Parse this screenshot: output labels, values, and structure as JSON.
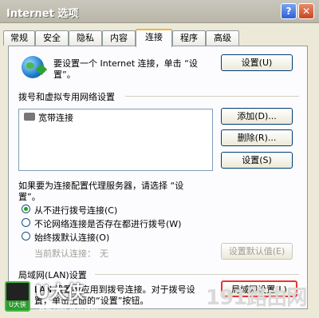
{
  "window": {
    "title": "Internet 选项",
    "help_label": "?",
    "close_label": "✕"
  },
  "tabs": [
    {
      "label": "常规"
    },
    {
      "label": "安全"
    },
    {
      "label": "隐私"
    },
    {
      "label": "内容"
    },
    {
      "label": "连接",
      "active": true
    },
    {
      "label": "程序"
    },
    {
      "label": "高级"
    }
  ],
  "setup": {
    "text_line1": "要设置一个 Internet 连接，单击 “设",
    "text_line2": "置”。",
    "button_label": "设置(U)"
  },
  "dialup": {
    "group_title": "拨号和虚拟专用网络设置",
    "connections": [
      "宽带连接"
    ],
    "add_label": "添加(D)...",
    "remove_label": "删除(R)...",
    "settings_label": "设置(S)"
  },
  "proxy": {
    "text_line1": "如果要为连接配置代理服务器，请选择 “设",
    "text_line2": "置”。",
    "options": [
      {
        "label": "从不进行拨号连接(C)",
        "selected": true
      },
      {
        "label": "不论网络连接是否存在都进行拨号(W)",
        "selected": false
      },
      {
        "label": "始终拨默认连接(O)",
        "selected": false
      }
    ],
    "current_default_label": "当前默认连接：",
    "current_default_value": "无",
    "set_default_label": "设置默认值(E)"
  },
  "lan": {
    "group_title": "局域网(LAN)设置",
    "text_line1": "LAN 设置不应用到拨号连接。对于拨号设",
    "text_line2": "置，单击上面的“设置”按钮。",
    "button_label": "局域网设置(L)"
  },
  "overlay": {
    "logo_text": "U大侠",
    "logo_badge": "U大侠",
    "logo_sub": "智能判断  傻瓜装机",
    "watermark": "191路由网"
  },
  "colors": {
    "panel_bg": "#fcfcfe",
    "dialog_bg": "#ece9d8",
    "accent_tab": "#f5b433",
    "radio_selected": "#21a121"
  }
}
